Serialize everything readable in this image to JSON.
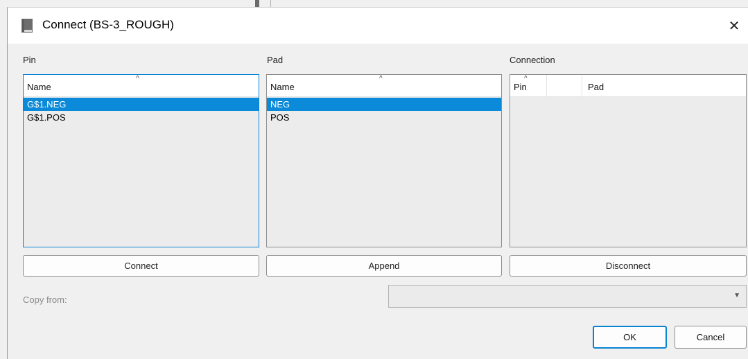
{
  "dialog": {
    "title": "Connect  (BS-3_ROUGH)",
    "close_glyph": "✕"
  },
  "pin": {
    "label": "Pin",
    "header": "Name",
    "sort_glyph": "^",
    "rows": [
      "G$1.NEG",
      "G$1.POS"
    ],
    "selected_index": 0
  },
  "pad": {
    "label": "Pad",
    "header": "Name",
    "sort_glyph": "^",
    "rows": [
      "NEG",
      "POS"
    ],
    "selected_index": 0
  },
  "connection": {
    "label": "Connection",
    "header_pin": "Pin",
    "header_pad": "Pad",
    "sort_glyph": "^",
    "rows": []
  },
  "buttons": {
    "connect": "Connect",
    "append": "Append",
    "disconnect": "Disconnect",
    "ok": "OK",
    "cancel": "Cancel"
  },
  "copy_from": {
    "label": "Copy from:",
    "value": "",
    "arrow_glyph": "▼"
  },
  "colors": {
    "accent": "#0a82d2",
    "selection": "#0a8ad8",
    "disabled_text": "#8a8a8a"
  },
  "icons": {
    "title_icon": "library-book-icon"
  }
}
